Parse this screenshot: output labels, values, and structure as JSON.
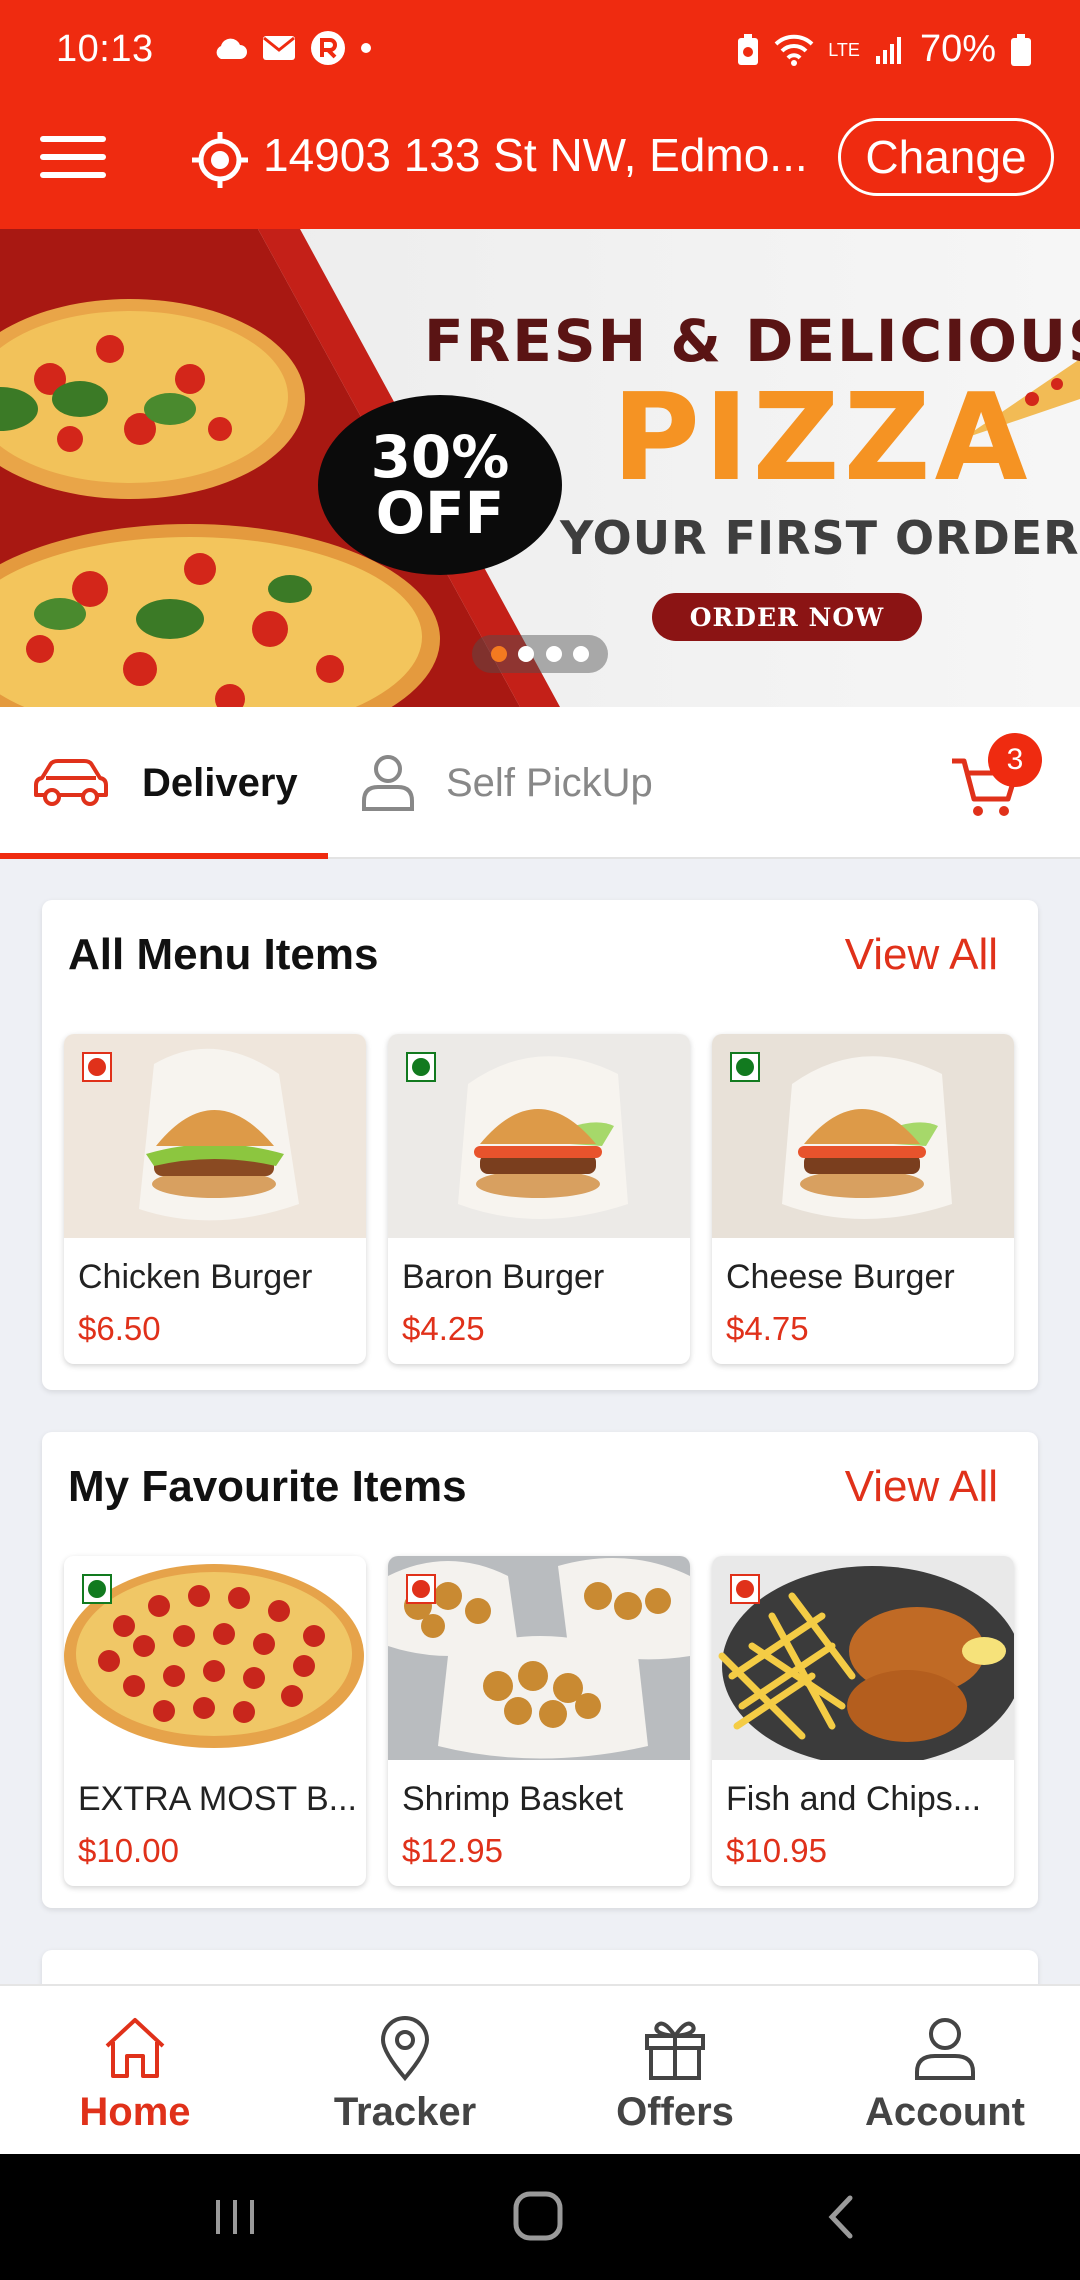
{
  "status_bar": {
    "time": "10:13",
    "battery": "70%",
    "network": "LTE",
    "icons": [
      "cloud-icon",
      "mail-icon",
      "app-badge-icon",
      "dot-icon",
      "battery-saver-icon",
      "wifi-icon",
      "signal-icon",
      "battery-icon"
    ]
  },
  "header": {
    "address": "14903 133 St NW, Edmo...",
    "change_label": "Change",
    "accent_color": "#ef2b10"
  },
  "banner": {
    "headline": "FRESH & DELICIOUS",
    "product": "PIZZA",
    "discount_line1": "30%",
    "discount_line2": "OFF",
    "subline": "YOUR FIRST ORDER",
    "cta": "ORDER NOW",
    "slide_count": 4,
    "active_slide": 1
  },
  "tabs": {
    "delivery": "Delivery",
    "pickup": "Self PickUp",
    "cart_count": "3"
  },
  "sections": [
    {
      "title": "All Menu Items",
      "view_all": "View All",
      "items": [
        {
          "name": "Chicken Burger",
          "price": "$6.50",
          "veg": false
        },
        {
          "name": "Baron Burger",
          "price": "$4.25",
          "veg": true
        },
        {
          "name": "Cheese Burger",
          "price": "$4.75",
          "veg": true
        }
      ]
    },
    {
      "title": "My Favourite Items",
      "view_all": "View All",
      "items": [
        {
          "name": "EXTRA MOST B...",
          "price": "$10.00",
          "veg": true
        },
        {
          "name": "Shrimp Basket",
          "price": "$12.95",
          "veg": false
        },
        {
          "name": "Fish and Chips...",
          "price": "$10.95",
          "veg": false
        }
      ]
    }
  ],
  "bottom_nav": {
    "home": "Home",
    "tracker": "Tracker",
    "offers": "Offers",
    "account": "Account",
    "active": "home"
  }
}
